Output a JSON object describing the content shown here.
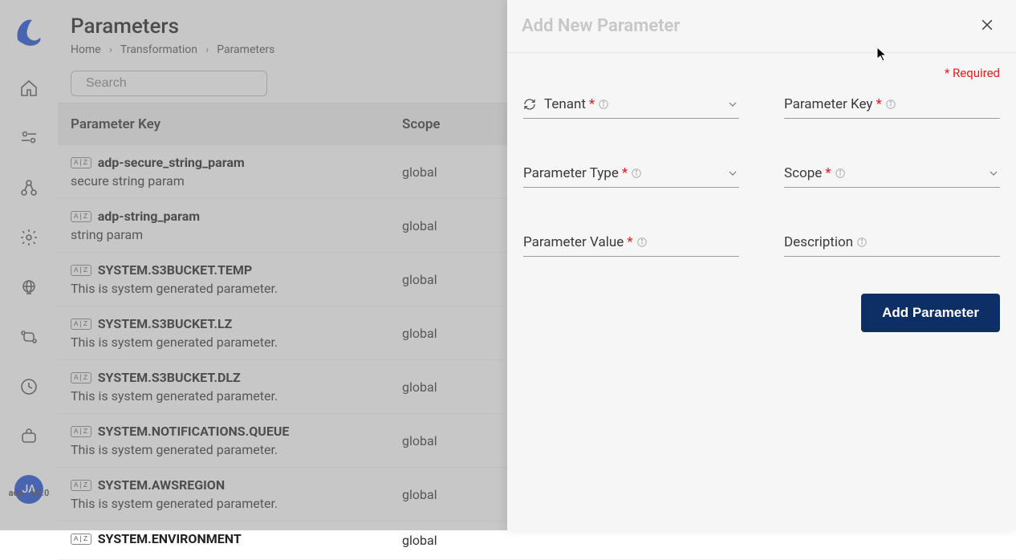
{
  "header": {
    "title": "Parameters",
    "breadcrumb": [
      "Home",
      "Transformation",
      "Parameters"
    ]
  },
  "search": {
    "placeholder": "Search"
  },
  "table": {
    "columns": [
      "Parameter Key",
      "Scope"
    ],
    "rows": [
      {
        "badge": "A|Z",
        "key": "adp-secure_string_param",
        "desc": "secure string param",
        "scope": "global"
      },
      {
        "badge": "A|Z",
        "key": "adp-string_param",
        "desc": "string param",
        "scope": "global"
      },
      {
        "badge": "A|Z",
        "key": "SYSTEM.S3BUCKET.TEMP",
        "desc": "This is system generated parameter.",
        "scope": "global"
      },
      {
        "badge": "A|Z",
        "key": "SYSTEM.S3BUCKET.LZ",
        "desc": "This is system generated parameter.",
        "scope": "global"
      },
      {
        "badge": "A|Z",
        "key": "SYSTEM.S3BUCKET.DLZ",
        "desc": "This is system generated parameter.",
        "scope": "global"
      },
      {
        "badge": "A|Z",
        "key": "SYSTEM.NOTIFICATIONS.QUEUE",
        "desc": "This is system generated parameter.",
        "scope": "global"
      },
      {
        "badge": "A|Z",
        "key": "SYSTEM.AWSREGION",
        "desc": "This is system generated parameter.",
        "scope": "global"
      },
      {
        "badge": "A|Z",
        "key": "SYSTEM.ENVIRONMENT",
        "desc": "",
        "scope": "global"
      }
    ]
  },
  "sidebar": {
    "avatar": "JA",
    "version": "adp - V2.0"
  },
  "panel": {
    "title": "Add New Parameter",
    "requiredText": "* Required",
    "fields": {
      "tenant": "Tenant",
      "paramKey": "Parameter Key",
      "paramType": "Parameter Type",
      "scope": "Scope",
      "paramValue": "Parameter Value",
      "description": "Description"
    },
    "submit": "Add Parameter"
  }
}
